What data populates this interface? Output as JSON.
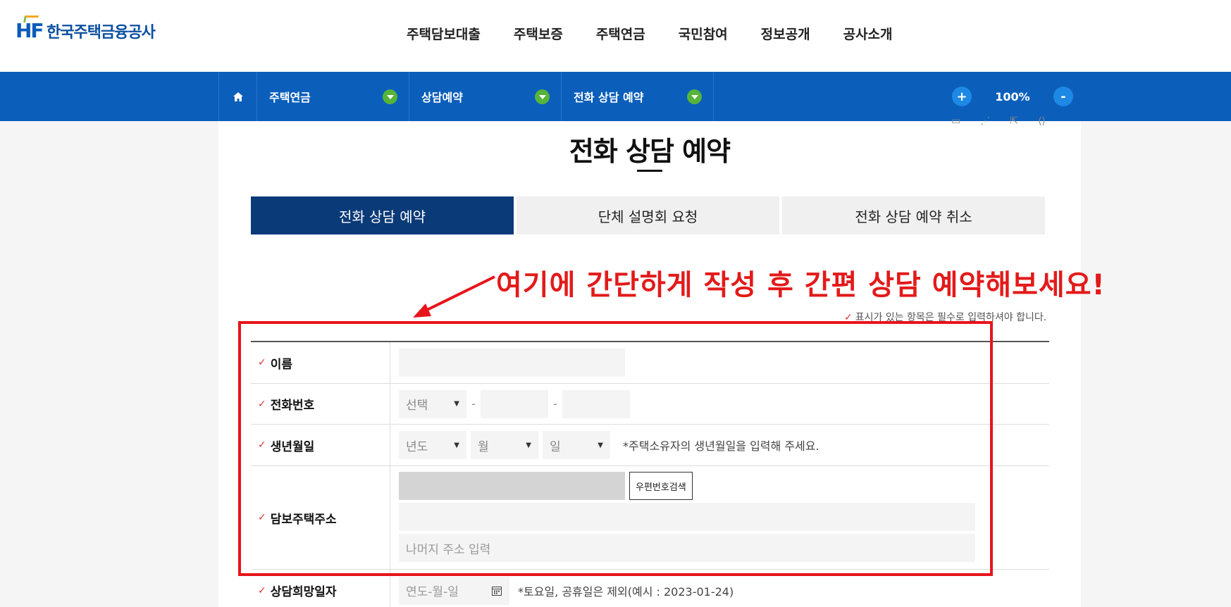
{
  "header": {
    "logo_mark": "HF",
    "logo_text": "한국주택금융공사",
    "nav": [
      "주택담보대출",
      "주택보증",
      "주택연금",
      "국민참여",
      "정보공개",
      "공사소개"
    ]
  },
  "location_bar": {
    "items": [
      "주택연금",
      "상담예약",
      "전화 상담 예약"
    ],
    "zoom_plus": "+",
    "zoom_value": "100%",
    "zoom_minus": "-"
  },
  "page": {
    "title": "전화 상담 예약",
    "tabs": [
      "전화 상담 예약",
      "단체 설명회 요청",
      "전화 상담 예약 취소"
    ],
    "callout": "여기에 간단하게 작성 후 간편 상담 예약해보세요!",
    "required_note": "표시가 있는 항목은 필수로 입력하셔야 합니다."
  },
  "form": {
    "name_label": "이름",
    "phone_label": "전화번호",
    "phone_select": "선택",
    "birth_label": "생년월일",
    "birth_year": "년도",
    "birth_month": "월",
    "birth_day": "일",
    "birth_hint": "*주택소유자의 생년월일을 입력해 주세요.",
    "address_label": "담보주택주소",
    "zip_button": "우편번호검색",
    "address_rest_placeholder": "나머지 주소 입력",
    "date_label": "상담희망일자",
    "date_placeholder": "연도-월-일",
    "date_hint": "*토요일, 공휴일은 제외(예시 : 2023-01-24)"
  },
  "colors": {
    "brand_blue": "#0b5fbb",
    "active_tab": "#0a3a78",
    "annotation_red": "#e31a1a"
  }
}
